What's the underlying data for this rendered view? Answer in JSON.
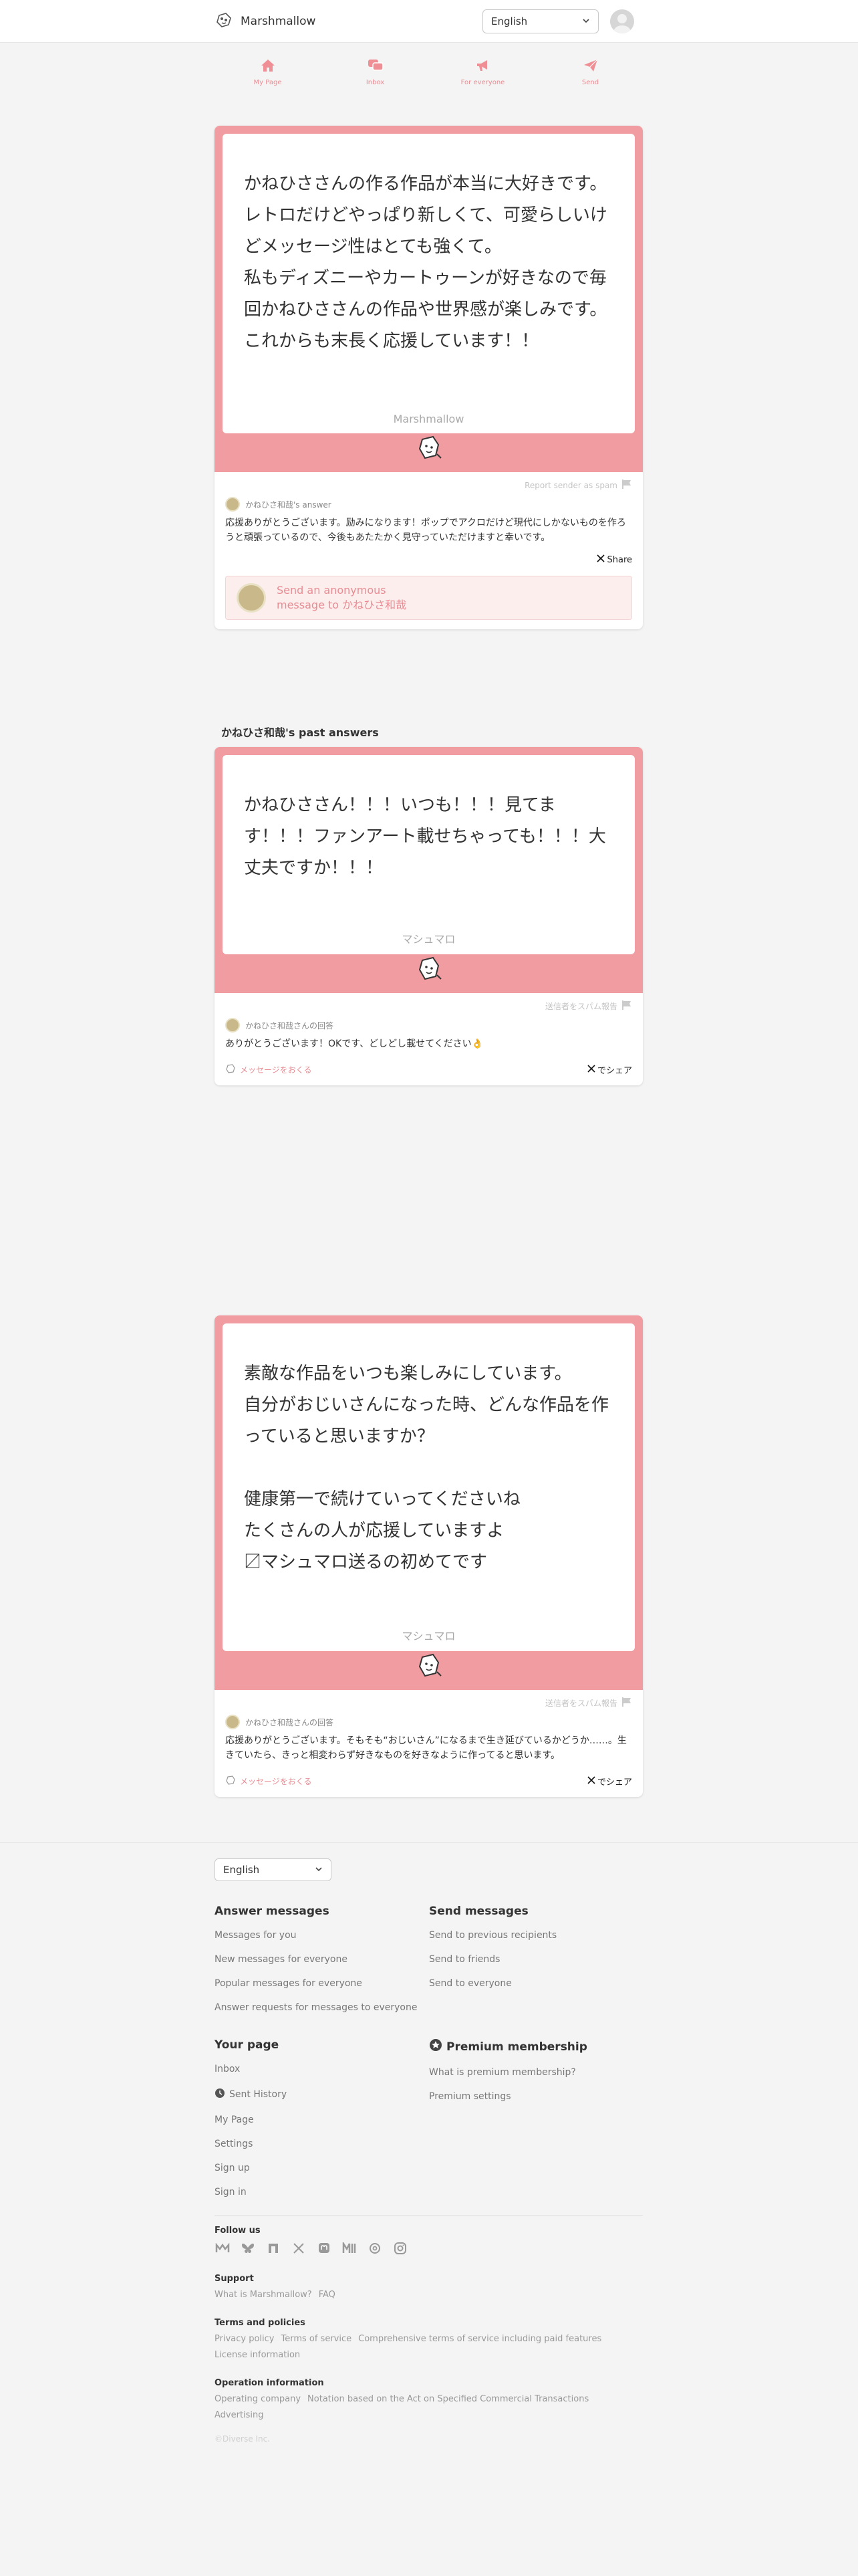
{
  "header": {
    "app_name": "Marshmallow",
    "language": "English"
  },
  "nav": [
    {
      "label": "My Page",
      "icon": "home-icon"
    },
    {
      "label": "Inbox",
      "icon": "chat-icon"
    },
    {
      "label": "For everyone",
      "icon": "megaphone-icon"
    },
    {
      "label": "Send",
      "icon": "paper-plane-icon"
    }
  ],
  "main_card": {
    "message": "かねひささんの作る作品が本当に大好きです。\nレトロだけどやっぱり新しくて、可愛らしいけどメッセージ性はとても強くて。\n私もディズニーやカートゥーンが好きなので毎回かねひささんの作品や世界感が楽しみです。\nこれからも末長く応援しています！！",
    "watermark": "Marshmallow",
    "report": "Report sender as spam",
    "answerer": "かねひさ和哉's answer",
    "answer": "応援ありがとうございます。励みになります！ポップでアクロだけど現代にしかないものを作ろうと頑張っているので、今後もあたたかく見守っていただけますと幸いです。",
    "share": "Share",
    "send_prompt_line1": "Send an anonymous",
    "send_prompt_line2": "message to かねひさ和哉"
  },
  "past_section_title": "かねひさ和哉's past answers",
  "past_cards": [
    {
      "message": "かねひささん！！！いつも！！！見てます！！！ファンアート載せちゃっても！！！大丈夫ですか！！！",
      "watermark": "マシュマロ",
      "report": "送信者をスパム報告",
      "answerer": "かねひさ和哉さんの回答",
      "answer": "ありがとうございます！OKです、どしどし載せてください👌",
      "send_link": "メッセージをおくる",
      "share": "でシェア"
    },
    {
      "message": "素敵な作品をいつも楽しみにしています。\n自分がおじいさんになった時、どんな作品を作っていると思いますか？\n\n健康第一で続けていってくださいね\nたくさんの人が応援していますよ\n〼マシュマロ送るの初めてです",
      "watermark": "マシュマロ",
      "report": "送信者をスパム報告",
      "answerer": "かねひさ和哉さんの回答",
      "answer": "応援ありがとうございます。そもそも“おじいさん”になるまで生き延びているかどうか……。生きていたら、きっと相変わらず好きなものを好きなように作ってると思います。",
      "send_link": "メッセージをおくる",
      "share": "でシェア"
    }
  ],
  "footer": {
    "language": "English",
    "answer_messages": {
      "title": "Answer messages",
      "links": [
        "Messages for you",
        "New messages for everyone",
        "Popular messages for everyone",
        "Answer requests for messages to everyone"
      ]
    },
    "send_messages": {
      "title": "Send messages",
      "links": [
        "Send to previous recipients",
        "Send to friends",
        "Send to everyone"
      ]
    },
    "your_page": {
      "title": "Your page",
      "links": [
        "Inbox",
        "Sent History",
        "My Page",
        "Settings",
        "Sign up",
        "Sign in"
      ]
    },
    "premium": {
      "title": "Premium membership",
      "links": [
        "What is premium membership?",
        "Premium settings"
      ]
    },
    "follow_us": "Follow us",
    "support": {
      "title": "Support",
      "links": [
        "What is Marshmallow?",
        "FAQ"
      ]
    },
    "terms": {
      "title": "Terms and policies",
      "links": [
        "Privacy policy",
        "Terms of service",
        "Comprehensive terms of service including paid features",
        "License information"
      ]
    },
    "operation": {
      "title": "Operation information",
      "links": [
        "Operating company",
        "Notation based on the Act on Specified Commercial Transactions",
        "Advertising"
      ]
    },
    "copyright": "©Diverse Inc."
  },
  "colors": {
    "accent": "#f09ca0",
    "accent_text": "#e88c93"
  }
}
